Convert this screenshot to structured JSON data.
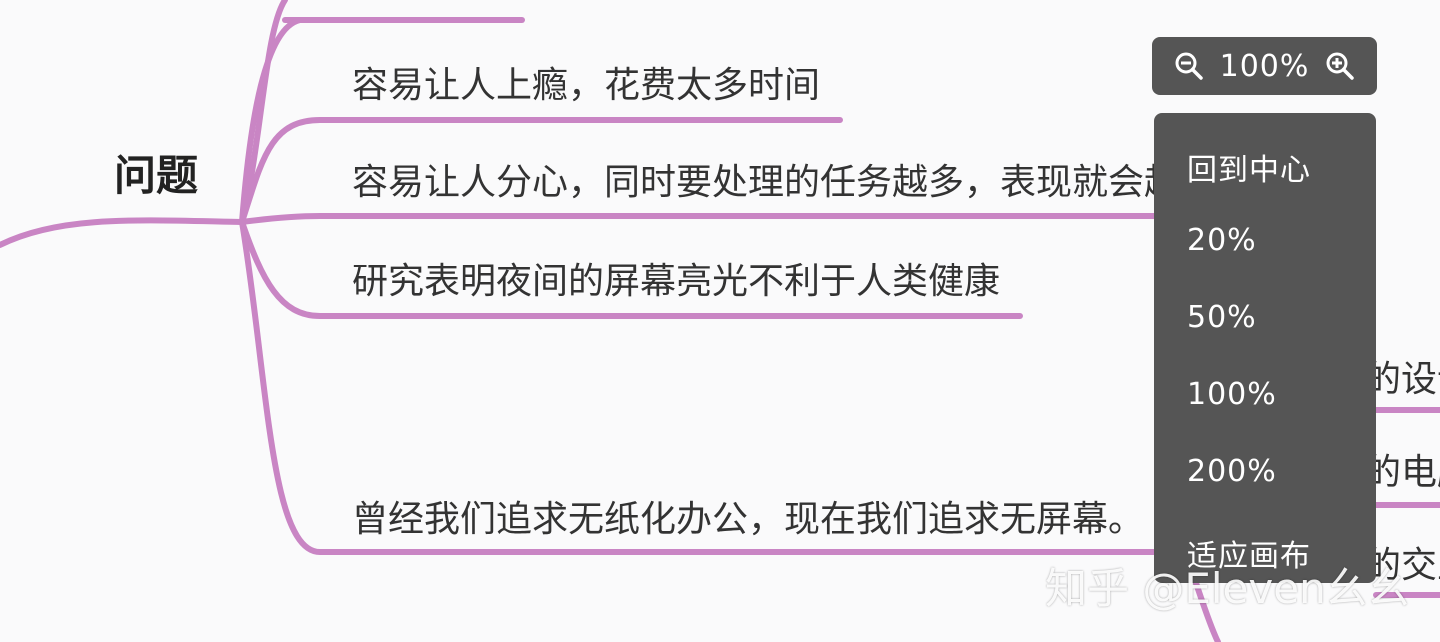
{
  "mindmap": {
    "root_label": "问题",
    "branches": [
      {
        "label": "容易让人上瘾，花费太多时间"
      },
      {
        "label": "容易让人分心，同时要处理的任务越多，表现就会越"
      },
      {
        "label": "研究表明夜间的屏幕亮光不利于人类健康"
      },
      {
        "label": "曾经我们追求无纸化办公，现在我们追求无屏幕。"
      }
    ],
    "right_partial": [
      {
        "label": "的设计"
      },
      {
        "label": "的电脑"
      },
      {
        "label": "的交互"
      }
    ],
    "branch_color": "#c985c4"
  },
  "zoom": {
    "value": "100%",
    "zoom_out_icon": "zoom-out-icon",
    "zoom_in_icon": "zoom-in-icon"
  },
  "zoom_menu": {
    "items": [
      "回到中心",
      "20%",
      "50%",
      "100%",
      "200%",
      "适应画布"
    ]
  },
  "watermark": {
    "text": "知乎 @Eleven幺幺"
  }
}
